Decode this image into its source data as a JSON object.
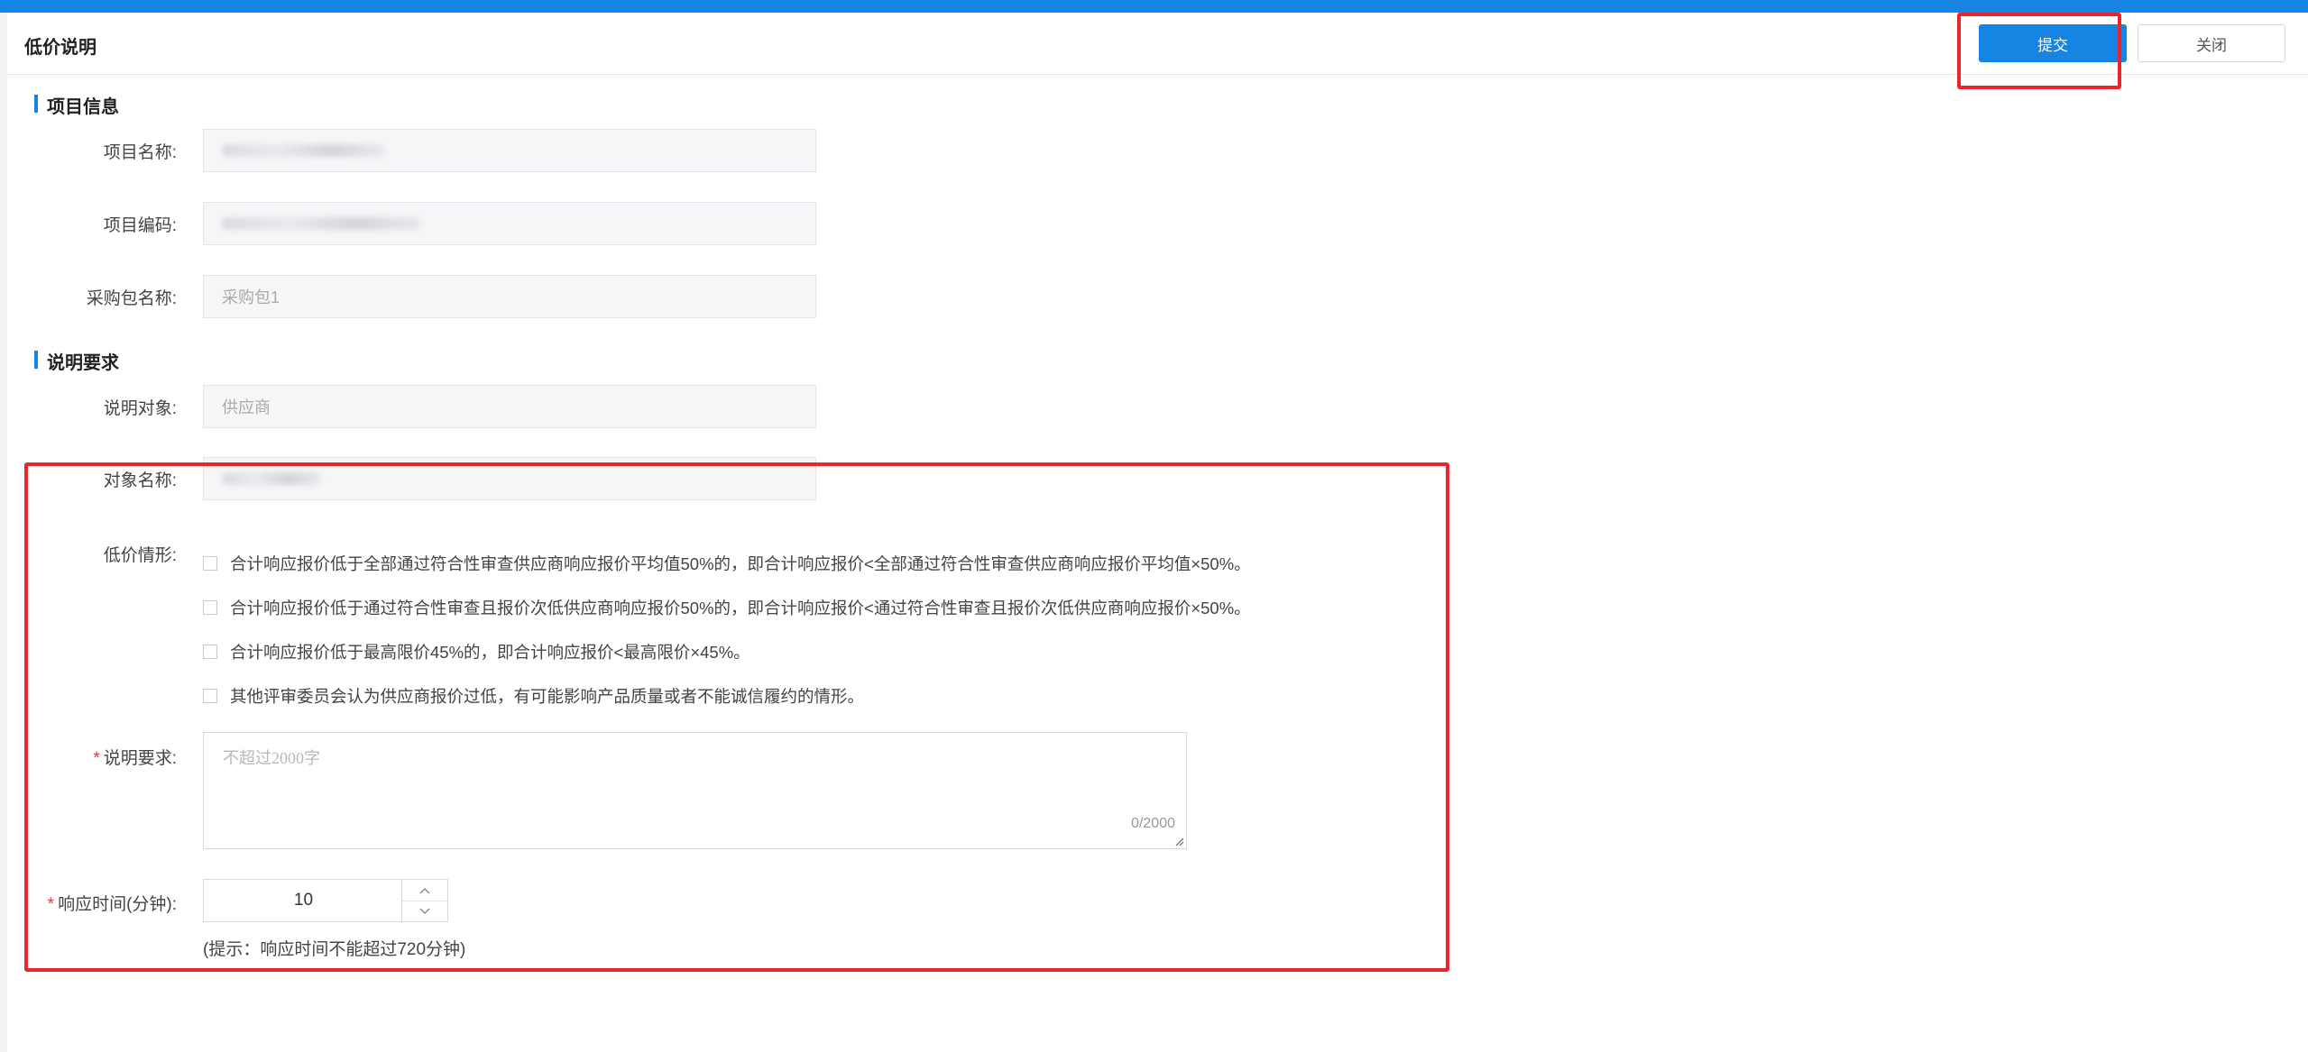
{
  "header": {
    "title": "低价说明",
    "submit_label": "提交",
    "close_label": "关闭"
  },
  "project_section": {
    "title": "项目信息",
    "fields": [
      {
        "label": "项目名称:",
        "value": ""
      },
      {
        "label": "项目编码:",
        "value": ""
      },
      {
        "label": "采购包名称:",
        "value": "采购包1"
      }
    ]
  },
  "requirement_section": {
    "title": "说明要求",
    "target_label": "说明对象:",
    "target_value": "供应商",
    "object_name_label": "对象名称:",
    "object_name_value": "",
    "low_price_label": "低价情形:",
    "low_price_options": [
      {
        "label": "合计响应报价低于全部通过符合性审查供应商响应报价平均值50%的，即合计响应报价<全部通过符合性审查供应商响应报价平均值×50%。",
        "checked": false
      },
      {
        "label": "合计响应报价低于通过符合性审查且报价次低供应商响应报价50%的，即合计响应报价<通过符合性审查且报价次低供应商响应报价×50%。",
        "checked": false
      },
      {
        "label": "合计响应报价低于最高限价45%的，即合计响应报价<最高限价×45%。",
        "checked": false
      },
      {
        "label": "其他评审委员会认为供应商报价过低，有可能影响产品质量或者不能诚信履约的情形。",
        "checked": false
      }
    ],
    "required_mark": "*",
    "explanation_label": "说明要求:",
    "explanation_placeholder": "不超过2000字",
    "explanation_counter": "0/2000",
    "response_time_label": "响应时间(分钟):",
    "response_time_value": "10",
    "response_time_hint": "(提示：响应时间不能超过720分钟)"
  },
  "colors": {
    "accent": "#1584e2",
    "annotation_red": "#e8262c",
    "required_red": "#e03a3a"
  }
}
